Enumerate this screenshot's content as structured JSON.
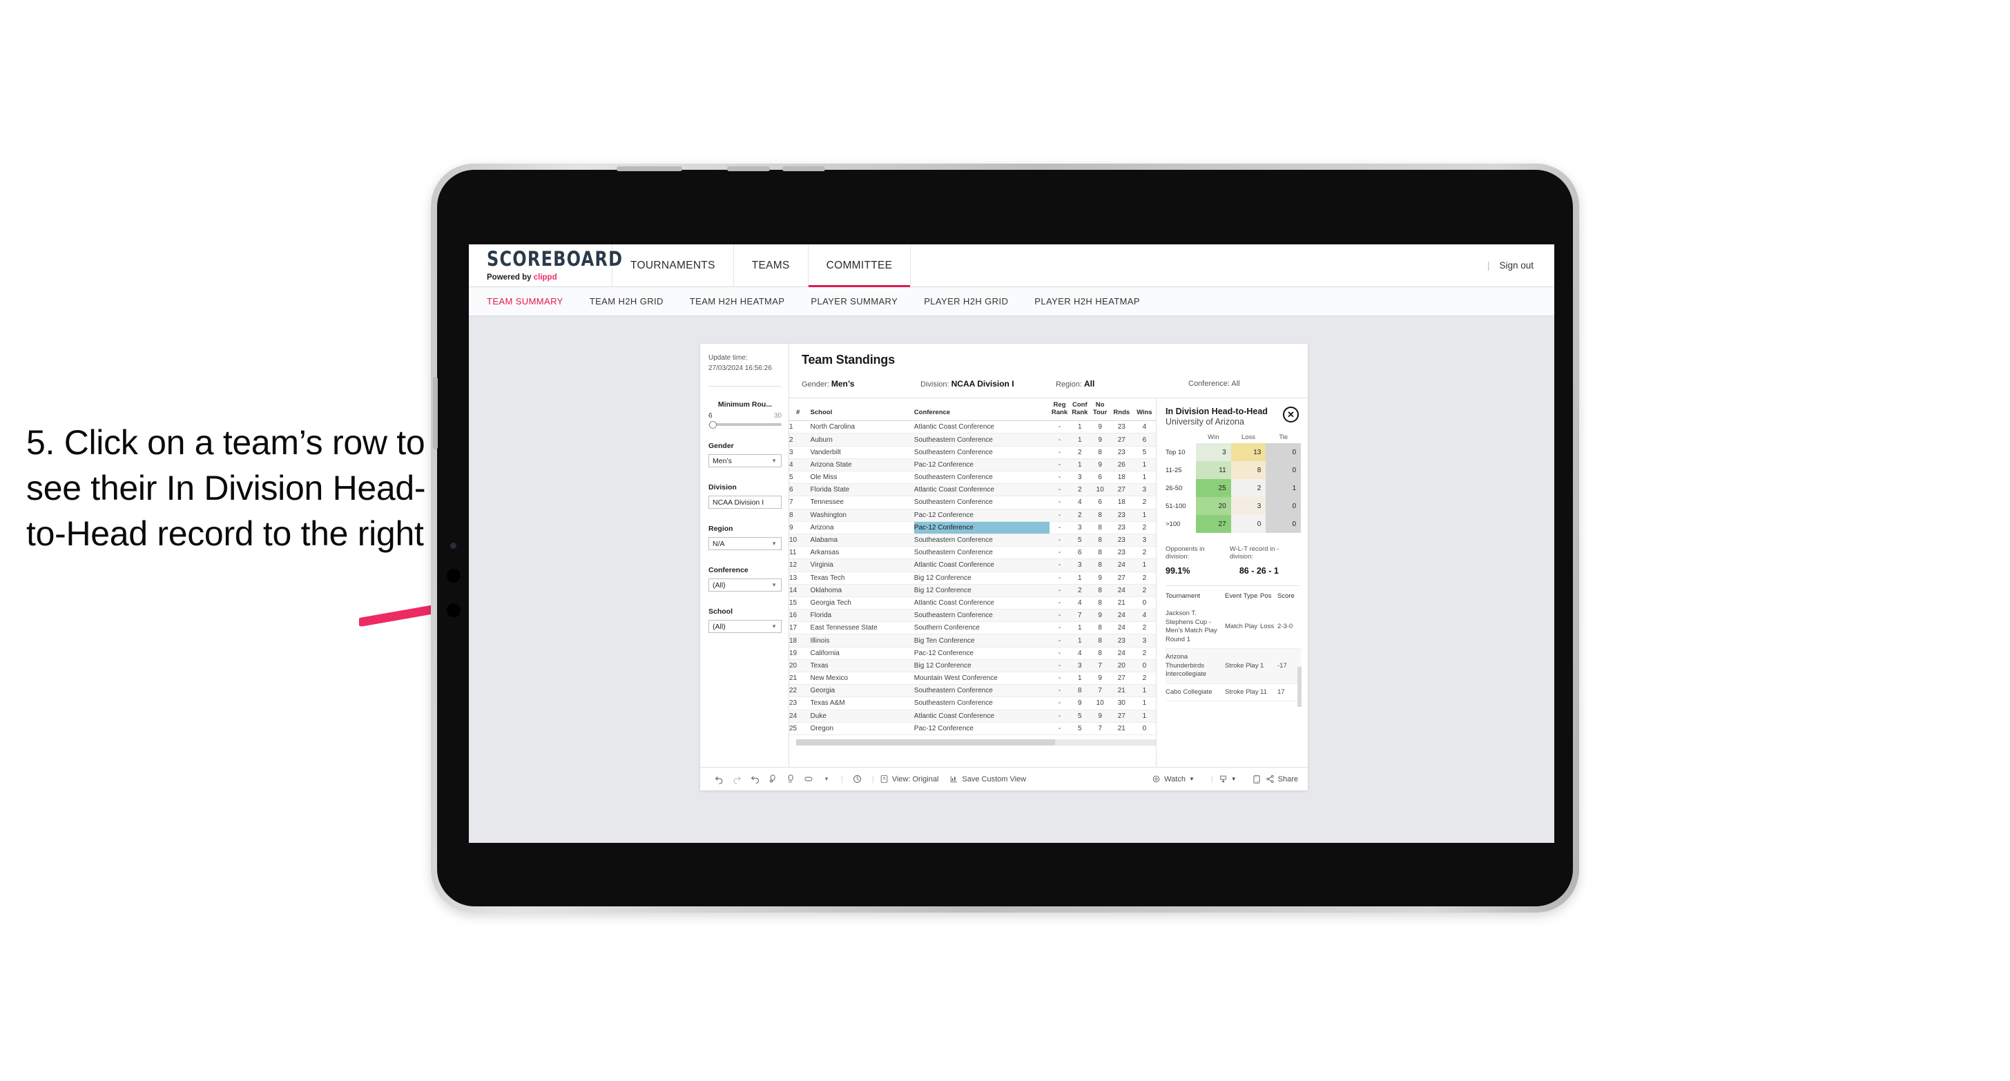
{
  "annotation": {
    "text": "5. Click on a team’s row to see their In Division Head-to-Head record to the right",
    "arrow_color": "#ed2a63"
  },
  "topnav": {
    "brand_name": "SCOREBOARD",
    "brand_sub_prefix": "Powered by ",
    "brand_sub_accent": "clippd",
    "items": [
      {
        "label": "TOURNAMENTS",
        "active": false
      },
      {
        "label": "TEAMS",
        "active": false
      },
      {
        "label": "COMMITTEE",
        "active": true
      }
    ],
    "divider": "|",
    "signout_label": "Sign out",
    "accent_color": "#e3174f"
  },
  "subnav": {
    "items": [
      {
        "label": "TEAM SUMMARY",
        "active": true
      },
      {
        "label": "TEAM H2H GRID",
        "active": false
      },
      {
        "label": "TEAM H2H HEATMAP",
        "active": false
      },
      {
        "label": "PLAYER SUMMARY",
        "active": false
      },
      {
        "label": "PLAYER H2H GRID",
        "active": false
      },
      {
        "label": "PLAYER H2H HEATMAP",
        "active": false
      }
    ]
  },
  "filter_rail": {
    "update_time_label": "Update time:",
    "update_time_value": "27/03/2024 16:56:26",
    "slider": {
      "title": "Minimum Rou...",
      "min": "6",
      "max": "30",
      "value": 6
    },
    "groups": [
      {
        "title": "Gender",
        "value": "Men’s"
      },
      {
        "title": "Division",
        "value": "NCAA Division I"
      },
      {
        "title": "Region",
        "value": "N/A"
      },
      {
        "title": "Conference",
        "value": "(All)"
      },
      {
        "title": "School",
        "value": "(All)"
      }
    ]
  },
  "viz": {
    "title": "Team Standings",
    "filters": [
      {
        "label": "Gender:",
        "value": "Men’s"
      },
      {
        "label": "Division:",
        "value": "NCAA Division I"
      },
      {
        "label": "Region:",
        "value": "All"
      },
      {
        "label": "Conference:",
        "value": "All"
      }
    ]
  },
  "standings": {
    "columns": [
      "#",
      "School",
      "Conference",
      "Reg Rank",
      "Conf Rank",
      "No Tour",
      "Rnds",
      "Wins"
    ],
    "column_head_lines": [
      [
        "#"
      ],
      [
        "School"
      ],
      [
        "Conference"
      ],
      [
        "Reg",
        "Rank"
      ],
      [
        "Conf",
        "Rank"
      ],
      [
        "No",
        "Tour"
      ],
      [
        "Rnds"
      ],
      [
        "Wins"
      ]
    ],
    "selected_row_index": 8,
    "rows": [
      {
        "n": "1",
        "school": "North Carolina",
        "conf": "Atlantic Coast Conference",
        "reg": "-",
        "cr": "1",
        "nt": "9",
        "rn": "23",
        "wi": "4"
      },
      {
        "n": "2",
        "school": "Auburn",
        "conf": "Southeastern Conference",
        "reg": "-",
        "cr": "1",
        "nt": "9",
        "rn": "27",
        "wi": "6"
      },
      {
        "n": "3",
        "school": "Vanderbilt",
        "conf": "Southeastern Conference",
        "reg": "-",
        "cr": "2",
        "nt": "8",
        "rn": "23",
        "wi": "5"
      },
      {
        "n": "4",
        "school": "Arizona State",
        "conf": "Pac-12 Conference",
        "reg": "-",
        "cr": "1",
        "nt": "9",
        "rn": "26",
        "wi": "1"
      },
      {
        "n": "5",
        "school": "Ole Miss",
        "conf": "Southeastern Conference",
        "reg": "-",
        "cr": "3",
        "nt": "6",
        "rn": "18",
        "wi": "1"
      },
      {
        "n": "6",
        "school": "Florida State",
        "conf": "Atlantic Coast Conference",
        "reg": "-",
        "cr": "2",
        "nt": "10",
        "rn": "27",
        "wi": "3"
      },
      {
        "n": "7",
        "school": "Tennessee",
        "conf": "Southeastern Conference",
        "reg": "-",
        "cr": "4",
        "nt": "6",
        "rn": "18",
        "wi": "2"
      },
      {
        "n": "8",
        "school": "Washington",
        "conf": "Pac-12 Conference",
        "reg": "-",
        "cr": "2",
        "nt": "8",
        "rn": "23",
        "wi": "1"
      },
      {
        "n": "9",
        "school": "Arizona",
        "conf": "Pac-12 Conference",
        "reg": "-",
        "cr": "3",
        "nt": "8",
        "rn": "23",
        "wi": "2"
      },
      {
        "n": "10",
        "school": "Alabama",
        "conf": "Southeastern Conference",
        "reg": "-",
        "cr": "5",
        "nt": "8",
        "rn": "23",
        "wi": "3"
      },
      {
        "n": "11",
        "school": "Arkansas",
        "conf": "Southeastern Conference",
        "reg": "-",
        "cr": "6",
        "nt": "8",
        "rn": "23",
        "wi": "2"
      },
      {
        "n": "12",
        "school": "Virginia",
        "conf": "Atlantic Coast Conference",
        "reg": "-",
        "cr": "3",
        "nt": "8",
        "rn": "24",
        "wi": "1"
      },
      {
        "n": "13",
        "school": "Texas Tech",
        "conf": "Big 12 Conference",
        "reg": "-",
        "cr": "1",
        "nt": "9",
        "rn": "27",
        "wi": "2"
      },
      {
        "n": "14",
        "school": "Oklahoma",
        "conf": "Big 12 Conference",
        "reg": "-",
        "cr": "2",
        "nt": "8",
        "rn": "24",
        "wi": "2"
      },
      {
        "n": "15",
        "school": "Georgia Tech",
        "conf": "Atlantic Coast Conference",
        "reg": "-",
        "cr": "4",
        "nt": "8",
        "rn": "21",
        "wi": "0"
      },
      {
        "n": "16",
        "school": "Florida",
        "conf": "Southeastern Conference",
        "reg": "-",
        "cr": "7",
        "nt": "9",
        "rn": "24",
        "wi": "4"
      },
      {
        "n": "17",
        "school": "East Tennessee State",
        "conf": "Southern Conference",
        "reg": "-",
        "cr": "1",
        "nt": "8",
        "rn": "24",
        "wi": "2"
      },
      {
        "n": "18",
        "school": "Illinois",
        "conf": "Big Ten Conference",
        "reg": "-",
        "cr": "1",
        "nt": "8",
        "rn": "23",
        "wi": "3"
      },
      {
        "n": "19",
        "school": "California",
        "conf": "Pac-12 Conference",
        "reg": "-",
        "cr": "4",
        "nt": "8",
        "rn": "24",
        "wi": "2"
      },
      {
        "n": "20",
        "school": "Texas",
        "conf": "Big 12 Conference",
        "reg": "-",
        "cr": "3",
        "nt": "7",
        "rn": "20",
        "wi": "0"
      },
      {
        "n": "21",
        "school": "New Mexico",
        "conf": "Mountain West Conference",
        "reg": "-",
        "cr": "1",
        "nt": "9",
        "rn": "27",
        "wi": "2"
      },
      {
        "n": "22",
        "school": "Georgia",
        "conf": "Southeastern Conference",
        "reg": "-",
        "cr": "8",
        "nt": "7",
        "rn": "21",
        "wi": "1"
      },
      {
        "n": "23",
        "school": "Texas A&M",
        "conf": "Southeastern Conference",
        "reg": "-",
        "cr": "9",
        "nt": "10",
        "rn": "30",
        "wi": "1"
      },
      {
        "n": "24",
        "school": "Duke",
        "conf": "Atlantic Coast Conference",
        "reg": "-",
        "cr": "5",
        "nt": "9",
        "rn": "27",
        "wi": "1"
      },
      {
        "n": "25",
        "school": "Oregon",
        "conf": "Pac-12 Conference",
        "reg": "-",
        "cr": "5",
        "nt": "7",
        "rn": "21",
        "wi": "0"
      }
    ]
  },
  "h2h": {
    "title": "In Division Head-to-Head",
    "subtitle": "University of Arizona",
    "close_icon": "✕",
    "chart_data": {
      "type": "heatmap",
      "title": "In Division Head-to-Head",
      "xlabel": "",
      "ylabel": "",
      "categories": [
        "Top 10",
        "11-25",
        "26-50",
        "51-100",
        ">100"
      ],
      "columns": [
        "Win",
        "Loss",
        "Tie"
      ],
      "values": [
        [
          3,
          13,
          0
        ],
        [
          11,
          8,
          0
        ],
        [
          25,
          2,
          1
        ],
        [
          20,
          3,
          0
        ],
        [
          27,
          0,
          0
        ]
      ],
      "cell_colors": [
        [
          "#e2eddd",
          "#f0e09a",
          "#d4d4d4"
        ],
        [
          "#cbe5c0",
          "#f5ead0",
          "#d4d4d4"
        ],
        [
          "#8ccf7b",
          "#f1f1ee",
          "#d4d4d4"
        ],
        [
          "#a6da93",
          "#f4eee2",
          "#d4d4d4"
        ],
        [
          "#8ccf7b",
          "#f2f2f0",
          "#d4d4d4"
        ]
      ]
    },
    "stats": [
      {
        "label": "Opponents in division:",
        "value": "99.1%"
      },
      {
        "label": "W-L-T record in -division:",
        "value": "86 - 26 - 1"
      }
    ],
    "tournaments": {
      "columns": [
        "Tournament",
        "Event Type",
        "Pos",
        "Score"
      ],
      "rows": [
        {
          "name": "Jackson T. Stephens Cup - Men’s Match Play Round 1",
          "type": "Match Play",
          "pos": "Loss",
          "score": "2-3-0"
        },
        {
          "name": "Arizona Thunderbirds Intercollegiate",
          "type": "Stroke Play",
          "pos": "1",
          "score": "-17"
        },
        {
          "name": "Cabo Collegiate",
          "type": "Stroke Play",
          "pos": "11",
          "score": "17"
        }
      ]
    }
  },
  "toolbar": {
    "undo_icon": "undo-icon",
    "redo_icon": "redo-icon",
    "revert_icon": "revert-icon",
    "refresh_icon": "refresh-icon",
    "pause_icon": "pause-icon",
    "view_label": "View: Original",
    "save_label": "Save Custom View",
    "watch_label": "Watch",
    "share_label": "Share"
  }
}
